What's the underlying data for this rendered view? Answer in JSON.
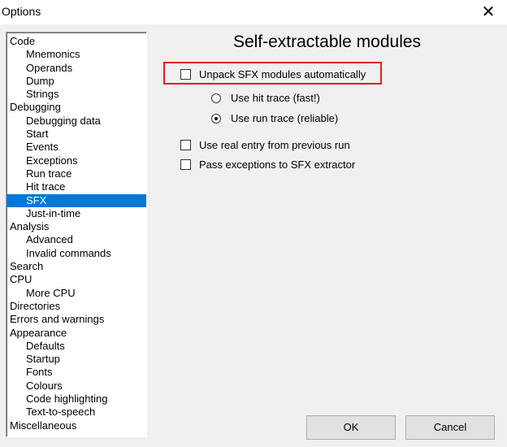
{
  "window": {
    "title": "Options",
    "close_glyph": "✕"
  },
  "tree": {
    "items": [
      {
        "label": "Code",
        "level": 0
      },
      {
        "label": "Mnemonics",
        "level": 1
      },
      {
        "label": "Operands",
        "level": 1
      },
      {
        "label": "Dump",
        "level": 1
      },
      {
        "label": "Strings",
        "level": 1
      },
      {
        "label": "Debugging",
        "level": 0
      },
      {
        "label": "Debugging data",
        "level": 1
      },
      {
        "label": "Start",
        "level": 1
      },
      {
        "label": "Events",
        "level": 1
      },
      {
        "label": "Exceptions",
        "level": 1
      },
      {
        "label": "Run trace",
        "level": 1
      },
      {
        "label": "Hit trace",
        "level": 1
      },
      {
        "label": "SFX",
        "level": 1,
        "selected": true
      },
      {
        "label": "Just-in-time",
        "level": 1
      },
      {
        "label": "Analysis",
        "level": 0
      },
      {
        "label": "Advanced",
        "level": 1
      },
      {
        "label": "Invalid commands",
        "level": 1
      },
      {
        "label": "Search",
        "level": 0
      },
      {
        "label": "CPU",
        "level": 0
      },
      {
        "label": "More CPU",
        "level": 1
      },
      {
        "label": "Directories",
        "level": 0
      },
      {
        "label": "Errors and warnings",
        "level": 0
      },
      {
        "label": "Appearance",
        "level": 0
      },
      {
        "label": "Defaults",
        "level": 1
      },
      {
        "label": "Startup",
        "level": 1
      },
      {
        "label": "Fonts",
        "level": 1
      },
      {
        "label": "Colours",
        "level": 1
      },
      {
        "label": "Code highlighting",
        "level": 1
      },
      {
        "label": "Text-to-speech",
        "level": 1
      },
      {
        "label": "Miscellaneous",
        "level": 0
      }
    ]
  },
  "panel": {
    "heading": "Self-extractable modules",
    "unpack_sfx": {
      "label": "Unpack SFX modules automatically",
      "checked": false
    },
    "use_hit_trace": {
      "label": "Use hit trace (fast!)",
      "selected": false
    },
    "use_run_trace": {
      "label": "Use run trace (reliable)",
      "selected": true
    },
    "use_real_entry": {
      "label": "Use real entry from previous run",
      "checked": false
    },
    "pass_exceptions": {
      "label": "Pass exceptions to SFX extractor",
      "checked": false
    }
  },
  "buttons": {
    "ok": "OK",
    "cancel": "Cancel"
  },
  "colors": {
    "selection": "#0078d7",
    "highlight_box": "#e01e24"
  }
}
